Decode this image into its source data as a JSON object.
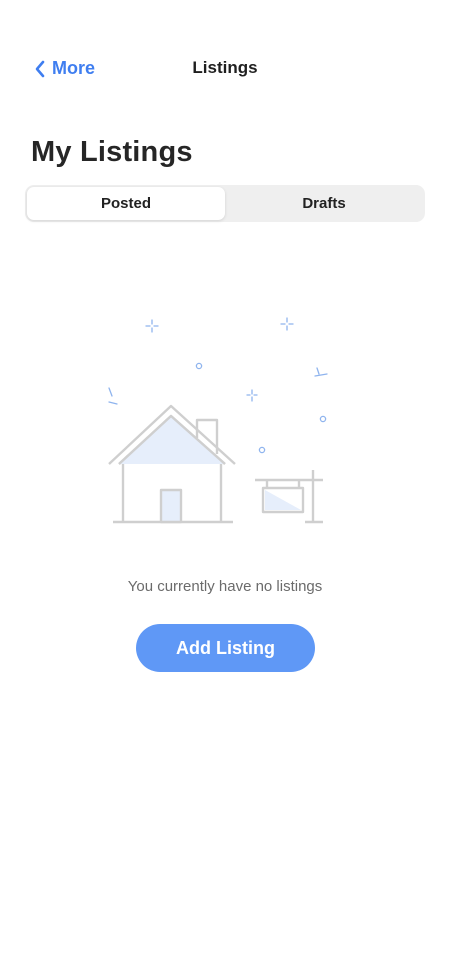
{
  "nav": {
    "back_label": "More",
    "title": "Listings"
  },
  "page": {
    "title": "My Listings"
  },
  "segments": [
    {
      "label": "Posted",
      "selected": true
    },
    {
      "label": "Drafts",
      "selected": false
    }
  ],
  "empty_state": {
    "message": "You currently have no listings",
    "illustration_icon": "house-with-sign-illustration"
  },
  "actions": {
    "add_listing_label": "Add Listing"
  },
  "colors": {
    "accent": "#3f7ef0",
    "button": "#5f98f6",
    "illustration_stroke": "#cfcfcf",
    "illustration_fill": "#e6eefb",
    "sparkle": "#8fb4ee"
  }
}
